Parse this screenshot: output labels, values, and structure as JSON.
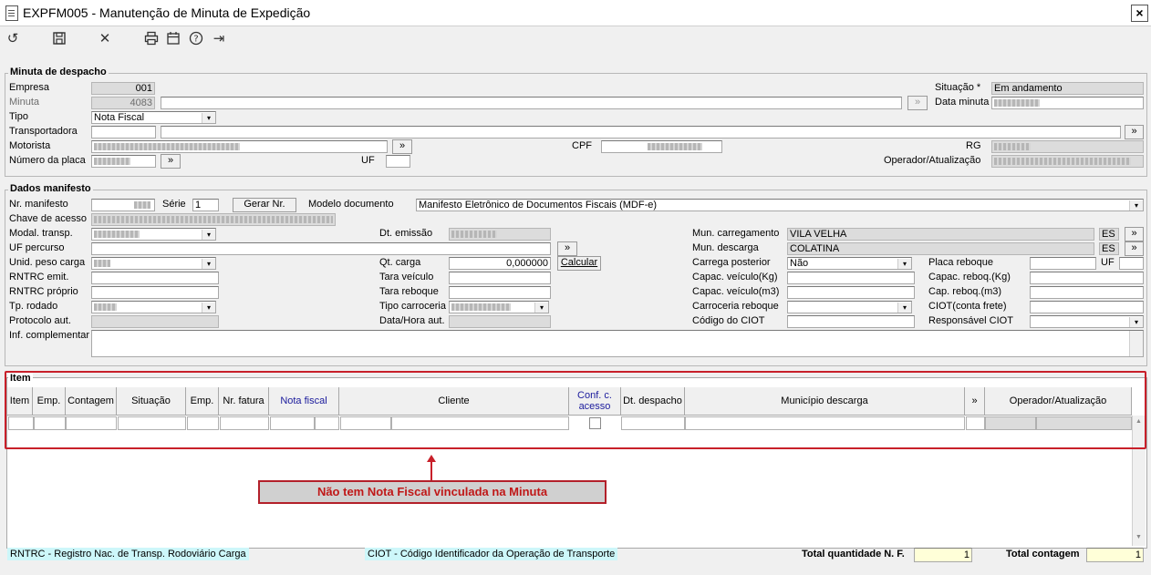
{
  "window": {
    "title": "EXPFM005 - Manutenção de Minuta de Expedição",
    "close": "×"
  },
  "toolbar": {
    "undo_icon": "↺",
    "save_icon": "💾",
    "cancel_icon": "✕",
    "print_icon": "⎙",
    "calendar_icon": "📅",
    "help_icon": "?",
    "exit_icon": "⇥"
  },
  "minuta": {
    "title": "Minuta de despacho",
    "empresa_label": "Empresa",
    "empresa": "001",
    "minuta_label": "Minuta",
    "minuta": "4083",
    "tipo_label": "Tipo",
    "tipo": "Nota Fiscal",
    "transportadora_label": "Transportadora",
    "motorista_label": "Motorista",
    "placa_label": "Número da placa",
    "uf_label": "UF",
    "cpf_label": "CPF",
    "rg_label": "RG",
    "situacao_label": "Situação *",
    "situacao": "Em andamento",
    "data_minuta_label": "Data minuta",
    "operador_label": "Operador/Atualização",
    "more_btn": "»"
  },
  "manifesto": {
    "title": "Dados manifesto",
    "nr_label": "Nr. manifesto",
    "serie_label": "Série",
    "serie": "1",
    "gerar_btn": "Gerar Nr.",
    "modelo_label": "Modelo documento",
    "modelo": "Manifesto Eletrônico de Documentos Fiscais (MDF-e)",
    "chave_label": "Chave de acesso",
    "modal_label": "Modal. transp.",
    "uf_percurso_label": "UF percurso",
    "unid_peso_label": "Unid. peso carga",
    "rntrc_emit_label": "RNTRC emit.",
    "rntrc_proprio_label": "RNTRC próprio",
    "tp_rodado_label": "Tp. rodado",
    "protocolo_label": "Protocolo aut.",
    "inf_label": "Inf. complementar",
    "dt_emissao_label": "Dt. emissão",
    "qt_carga_label": "Qt. carga",
    "qt_carga": "0,000000",
    "calcular_btn": "Calcular",
    "tara_veiculo_label": "Tara veículo",
    "tara_reboque_label": "Tara reboque",
    "tipo_carroceria_label": "Tipo carroceria",
    "data_hora_label": "Data/Hora aut.",
    "mun_carregamento_label": "Mun. carregamento",
    "mun_carregamento": "VILA VELHA",
    "uf_carregamento": "ES",
    "mun_descarga_label": "Mun. descarga",
    "mun_descarga": "COLATINA",
    "uf_descarga": "ES",
    "carrega_posterior_label": "Carrega posterior",
    "carrega_posterior": "Não",
    "capac_kg_label": "Capac. veículo(Kg)",
    "capac_m3_label": "Capac. veículo(m3)",
    "carroceria_reboque_label": "Carroceria reboque",
    "codigo_ciot_label": "Código do CIOT",
    "placa_reboque_label": "Placa reboque",
    "uf_reboque_label": "UF",
    "cap_reboq_kg_label": "Capac. reboq.(Kg)",
    "cap_reboq_m3_label": "Cap. reboq.(m3)",
    "ciot_frete_label": "CIOT(conta frete)",
    "resp_ciot_label": "Responsável CIOT"
  },
  "item": {
    "title": "Item",
    "columns": [
      "Item",
      "Emp.",
      "Contagem",
      "Situação",
      "Emp.",
      "Nr. fatura",
      "Nota fiscal",
      "Cliente",
      "Conf. c. acesso",
      "Dt. despacho",
      "Município descarga",
      "»",
      "Operador/Atualização"
    ]
  },
  "callout": "Não tem Nota Fiscal vinculada na Minuta",
  "footer": {
    "rntrc_legend": "RNTRC - Registro Nac. de Transp. Rodoviário Carga",
    "ciot_legend": "CIOT - Código Identificador da Operação de Transporte",
    "total_nf_label": "Total quantidade N. F.",
    "total_nf": "1",
    "total_contagem_label": "Total contagem",
    "total_contagem": "1"
  },
  "colors": {
    "accent_red": "#c8202a",
    "legend_bg": "#cdf7fa",
    "total_bg": "#ffffd8",
    "link_blue": "#1a1a9c"
  }
}
